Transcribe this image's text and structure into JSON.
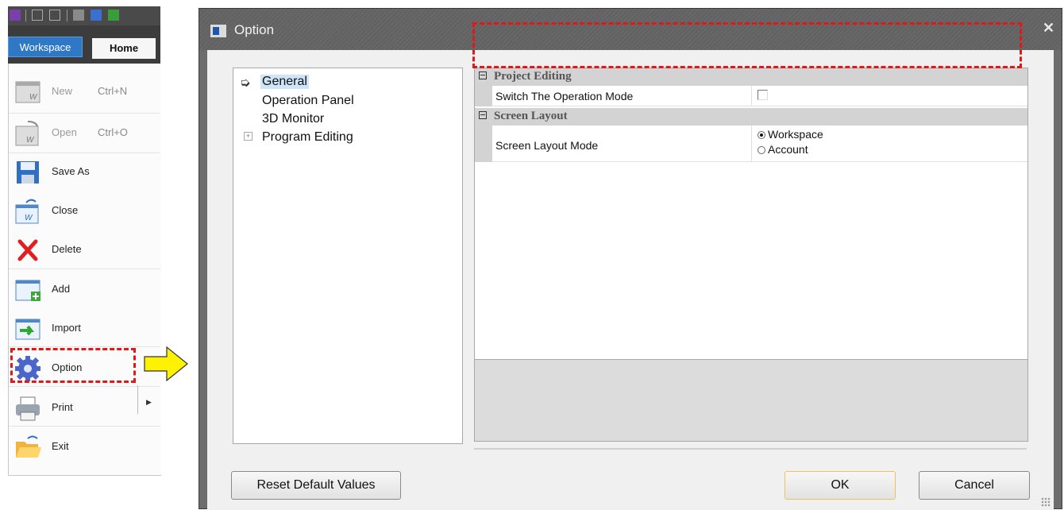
{
  "app_menu": {
    "tabs": {
      "workspace": "Workspace",
      "home": "Home"
    },
    "items": [
      {
        "label": "New",
        "shortcut": "Ctrl+N",
        "icon": "new-workspace-icon",
        "disabled": true
      },
      {
        "label": "Open",
        "shortcut": "Ctrl+O",
        "icon": "open-workspace-icon",
        "disabled": true
      },
      {
        "label": "Save As",
        "shortcut": "",
        "icon": "save-icon",
        "disabled": false
      },
      {
        "label": "Close",
        "shortcut": "",
        "icon": "close-workspace-icon",
        "disabled": false
      },
      {
        "label": "Delete",
        "shortcut": "",
        "icon": "delete-x-icon",
        "disabled": false
      },
      {
        "label": "Add",
        "shortcut": "",
        "icon": "add-window-icon",
        "disabled": false
      },
      {
        "label": "Import",
        "shortcut": "",
        "icon": "import-arrow-icon",
        "disabled": false
      },
      {
        "label": "Option",
        "shortcut": "",
        "icon": "gear-icon",
        "disabled": false
      },
      {
        "label": "Print",
        "shortcut": "",
        "icon": "printer-icon",
        "disabled": false
      },
      {
        "label": "Exit",
        "shortcut": "",
        "icon": "folder-exit-icon",
        "disabled": false
      }
    ]
  },
  "dialog": {
    "title": "Option",
    "tree": {
      "general": "General",
      "operation_panel": "Operation Panel",
      "monitor_3d": "3D Monitor",
      "program_editing": "Program Editing"
    },
    "grid": {
      "cat_project_editing": "Project Editing",
      "prop_switch_mode": "Switch The Operation Mode",
      "switch_mode_checked": false,
      "cat_screen_layout": "Screen Layout",
      "prop_screen_layout_mode": "Screen Layout Mode",
      "radio_workspace": "Workspace",
      "radio_account": "Account",
      "selected_layout": "Workspace"
    },
    "buttons": {
      "reset": "Reset Default Values",
      "ok": "OK",
      "cancel": "Cancel"
    }
  },
  "colors": {
    "highlight_dashed": "#e01818",
    "callout_arrow": "#fff200",
    "workspace_tab": "#2f78c5"
  }
}
